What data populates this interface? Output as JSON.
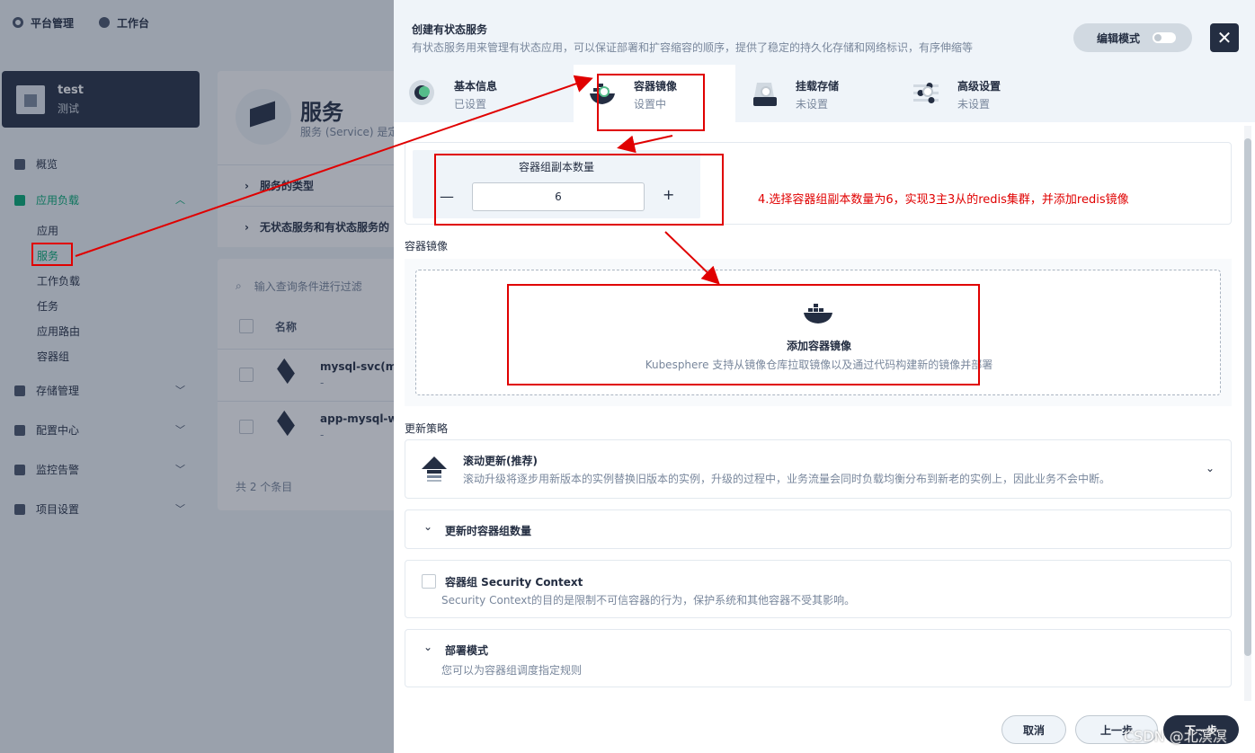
{
  "topbar": {
    "platform": "平台管理",
    "workbench": "工作台"
  },
  "project": {
    "name": "test",
    "desc": "测试"
  },
  "sidebar": {
    "items": [
      {
        "label": "概览"
      },
      {
        "label": "应用负载"
      },
      {
        "label": "存储管理"
      },
      {
        "label": "配置中心"
      },
      {
        "label": "监控告警"
      },
      {
        "label": "项目设置"
      }
    ],
    "subitems": [
      {
        "label": "应用"
      },
      {
        "label": "服务"
      },
      {
        "label": "工作负载"
      },
      {
        "label": "任务"
      },
      {
        "label": "应用路由"
      },
      {
        "label": "容器组"
      }
    ]
  },
  "page": {
    "title": "服务",
    "desc": "服务 (Service) 是定",
    "expand1": "服务的类型",
    "expand2": "无状态服务和有状态服务的",
    "search_placeholder": "输入查询条件进行过滤",
    "col_name": "名称",
    "rows": [
      {
        "name": "mysql-svc(mys",
        "sub": "-"
      },
      {
        "name": "app-mysql-wy",
        "sub": "-"
      }
    ],
    "total": "共 2 个条目"
  },
  "modal": {
    "title": "创建有状态服务",
    "desc": "有状态服务用来管理有状态应用，可以保证部署和扩容缩容的顺序，提供了稳定的持久化存储和网络标识，有序伸缩等",
    "edit_mode": "编辑模式",
    "steps": [
      {
        "label": "基本信息",
        "status": "已设置"
      },
      {
        "label": "容器镜像",
        "status": "设置中"
      },
      {
        "label": "挂载存储",
        "status": "未设置"
      },
      {
        "label": "高级设置",
        "status": "未设置"
      }
    ],
    "replica_label": "容器组副本数量",
    "replica_value": "6",
    "annotation": "4.选择容器组副本数量为6，实现3主3从的redis集群，并添加redis镜像",
    "image_section": "容器镜像",
    "add_image_title": "添加容器镜像",
    "add_image_desc": "Kubesphere 支持从镜像仓库拉取镜像以及通过代码构建新的镜像并部署",
    "update_section": "更新策略",
    "rolling_title": "滚动更新(推荐)",
    "rolling_desc": "滚动升级将逐步用新版本的实例替换旧版本的实例，升级的过程中，业务流量会同时负载均衡分布到新老的实例上，因此业务不会中断。",
    "update_count_title": "更新时容器组数量",
    "security_title": "容器组 Security Context",
    "security_desc": "Security Context的目的是限制不可信容器的行为，保护系统和其他容器不受其影响。",
    "deploy_title": "部署模式",
    "deploy_desc": "您可以为容器组调度指定规则",
    "btn_cancel": "取消",
    "btn_prev": "上一步",
    "btn_next": "下一步"
  },
  "watermark": "CSDN @北溟溟",
  "colors": {
    "accent": "#00aa72",
    "annotation": "#e00000",
    "dark": "#242e42"
  }
}
